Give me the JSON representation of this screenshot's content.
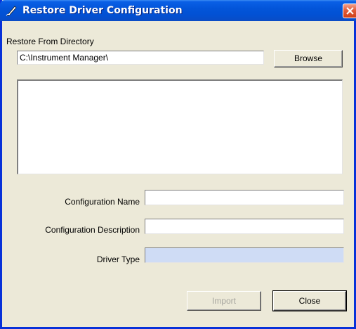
{
  "window": {
    "title": "Restore Driver Configuration",
    "icon": "pen-icon",
    "close_icon": "close-icon"
  },
  "restore": {
    "label": "Restore From Directory",
    "path_value": "C:\\Instrument Manager\\",
    "browse_label": "Browse"
  },
  "form": {
    "config_name_label": "Configuration Name",
    "config_name_value": "",
    "config_desc_label": "Configuration Description",
    "config_desc_value": "",
    "driver_type_label": "Driver Type",
    "driver_type_value": ""
  },
  "buttons": {
    "import_label": "Import",
    "close_label": "Close"
  },
  "colors": {
    "titlebar": "#0355d9",
    "dialog_bg": "#ece9d8",
    "disabled_field": "#cfdcf5"
  }
}
